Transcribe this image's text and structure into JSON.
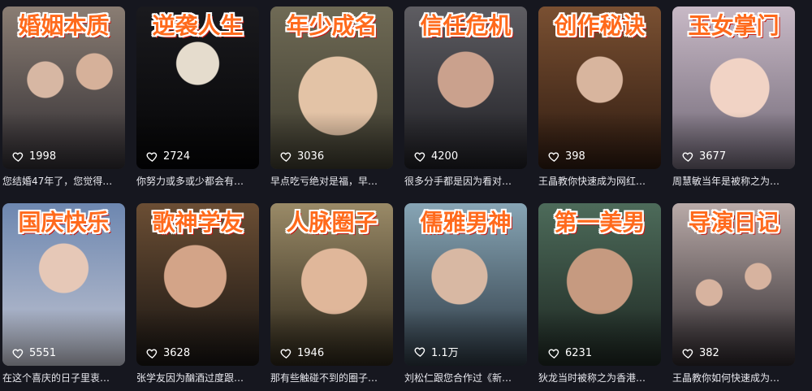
{
  "cards": [
    {
      "title": "婚姻本质",
      "likes": "1998",
      "caption": "您结婚47年了，您觉得…"
    },
    {
      "title": "逆袭人生",
      "likes": "2724",
      "caption": "你努力或多或少都会有…"
    },
    {
      "title": "年少成名",
      "likes": "3036",
      "caption": "早点吃亏绝对是福，早…"
    },
    {
      "title": "信任危机",
      "likes": "4200",
      "caption": "很多分手都是因为看对…"
    },
    {
      "title": "创作秘诀",
      "likes": "398",
      "caption": "王晶教你快速成为网红…"
    },
    {
      "title": "玉女掌门",
      "likes": "3677",
      "caption": "周慧敏当年是被称之为…"
    },
    {
      "title": "国庆快乐",
      "likes": "5551",
      "caption": "在这个喜庆的日子里衷…"
    },
    {
      "title": "歌神学友",
      "likes": "3628",
      "caption": "张学友因为酗酒过度跟…"
    },
    {
      "title": "人脉圈子",
      "likes": "1946",
      "caption": "那有些触碰不到的圈子…"
    },
    {
      "title": "儒雅男神",
      "likes": "1.1万",
      "caption": "刘松仁跟您合作过《新…"
    },
    {
      "title": "第一美男",
      "likes": "6231",
      "caption": "狄龙当时被称之为香港…"
    },
    {
      "title": "导演日记",
      "likes": "382",
      "caption": "王晶教你如何快速成为…"
    }
  ],
  "icons": {
    "likes": "heart-icon"
  },
  "colors": {
    "background": "#16171f",
    "title_fill": "#ff6a1c",
    "title_shadow": "#c81b10"
  }
}
